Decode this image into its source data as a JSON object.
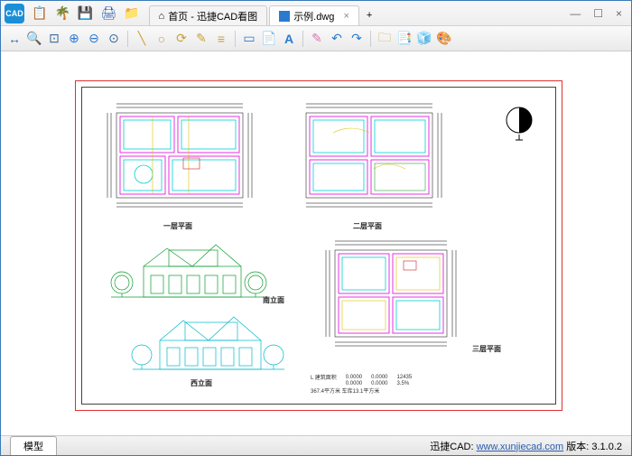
{
  "app": {
    "logo_text": "CAD"
  },
  "titlebar_icons": {
    "a": "📋",
    "b": "🌴",
    "c": "💾",
    "d": "🖨",
    "e": "📁"
  },
  "tabs": {
    "home": {
      "label": "首页 - 迅捷CAD看图",
      "icon": "⌂"
    },
    "file": {
      "label": "示例.dwg",
      "close": "×"
    },
    "plus": "+"
  },
  "winctl": {
    "min": "—",
    "max": "☐",
    "close": "×"
  },
  "tools": [
    "↔",
    "🔍",
    "⊕",
    "🔍",
    "⊖",
    "⊙",
    "|",
    "╲",
    "○",
    "⟳",
    "✎",
    "≡",
    "|",
    "▭",
    "📄",
    "A",
    "|",
    "✎",
    "↶",
    "↷",
    "|",
    "🗀",
    "📄",
    "🧊",
    "⋯"
  ],
  "captions": {
    "fp1": "一层平面",
    "fp2": "二层平面",
    "elev1": "南立面",
    "elev2": "西立面",
    "fp3": "三层平面"
  },
  "legend": {
    "title": "L 建筑面积",
    "r1a": "0.0000",
    "r1b": "0.0000",
    "r1c": "12435",
    "r2a": "0.0000",
    "r2b": "0.0000",
    "r2c": "3.5%",
    "note": "367.4平方米 车库13.1平方米"
  },
  "bottom": {
    "model": "模型",
    "brand": "迅捷CAD: ",
    "url": "www.xunjiecad.com",
    "ver": " 版本: 3.1.0.2"
  }
}
